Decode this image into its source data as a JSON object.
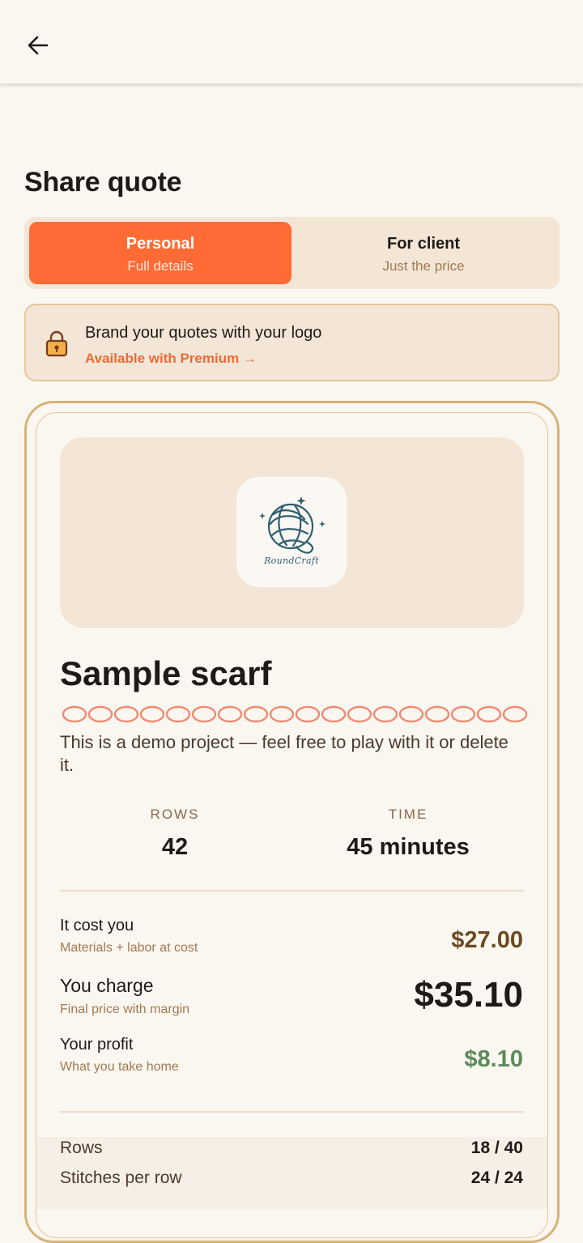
{
  "header": {
    "back_icon": "arrow-left-icon"
  },
  "page": {
    "title": "Share quote"
  },
  "mode_toggle": {
    "personal": {
      "title": "Personal",
      "subtitle": "Full details",
      "selected": true
    },
    "client": {
      "title": "For client",
      "subtitle": "Just the price",
      "selected": false
    }
  },
  "premium_banner": {
    "icon": "lock-icon",
    "title": "Brand your quotes with your logo",
    "link": "Available with Premium →"
  },
  "quote_card": {
    "logo_text": "RoundCraft",
    "project_name": "Sample scarf",
    "description": "This is a demo project — feel free to play with it or delete it.",
    "stats": [
      {
        "label": "ROWS",
        "value": "42"
      },
      {
        "label": "TIME",
        "value": "45 minutes"
      }
    ],
    "cost": {
      "label": "It cost you",
      "sub": "Materials + labor at cost",
      "amount": "$27.00"
    },
    "charge": {
      "label": "You charge",
      "sub": "Final price with margin",
      "amount": "$35.10"
    },
    "profit": {
      "label": "Your profit",
      "sub": "What you take home",
      "amount": "$8.10"
    },
    "details": [
      {
        "label": "Rows",
        "value": "18 / 40"
      },
      {
        "label": "Stitches per row",
        "value": "24 / 24"
      }
    ]
  },
  "colors": {
    "accent": "#ff6b35",
    "cost": "#6b4a22",
    "profit": "#5d8a5a",
    "border": "#d6b477"
  }
}
